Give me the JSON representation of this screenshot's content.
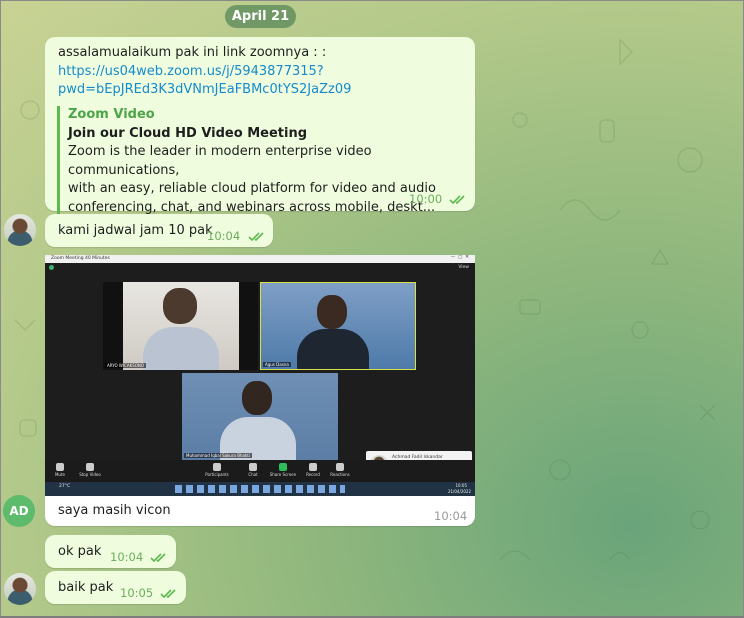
{
  "date": "April 21",
  "messages": [
    {
      "text": "assalamualaikum pak ini link zoomnya : :",
      "link_line1": "https://us04web.zoom.us/j/5943877315?",
      "link_line2": "pwd=bEpJREd3K3dVNmJEaFBMc0tYS2JaZz09",
      "preview_site": "Zoom Video",
      "preview_title": "Join our Cloud HD Video Meeting",
      "preview_desc1": "Zoom is the leader in modern enterprise video communications,",
      "preview_desc2": "with an easy, reliable cloud platform for video and audio",
      "preview_desc3": "conferencing, chat, and webinars across mobile, deskt...",
      "time": "10:00"
    },
    {
      "text": "kami jadwal jam 10 pak",
      "time": "10:04"
    },
    {
      "text": "saya masih vicon",
      "time": "10:04",
      "avatar": "AD"
    },
    {
      "text": "ok pak",
      "time": "10:04"
    },
    {
      "text": "baik pak",
      "time": "10:05"
    }
  ],
  "screenshot": {
    "window_title": "Zoom Meeting 40 Minutes",
    "view_label": "View",
    "participants": [
      "ARYO WICAKSONO",
      "Agus Dasna",
      "Muhammad Iqbal Sakura Bhakti"
    ],
    "toolbar": [
      "Mute",
      "Stop Video",
      "Participants",
      "Chat",
      "Share Screen",
      "Record",
      "Reactions"
    ],
    "notification_name": "Achmad Fadil Iskandar",
    "notification_msg": "kami jadwal jam 10 pak",
    "taskbar_weather": "27°C",
    "taskbar_clock": "10:05",
    "taskbar_date": "21/04/2022"
  },
  "colors": {
    "outgoing_bubble": "#effdde",
    "incoming_bubble": "#ffffff",
    "link": "#168acd",
    "accent_green": "#5eb94e"
  }
}
